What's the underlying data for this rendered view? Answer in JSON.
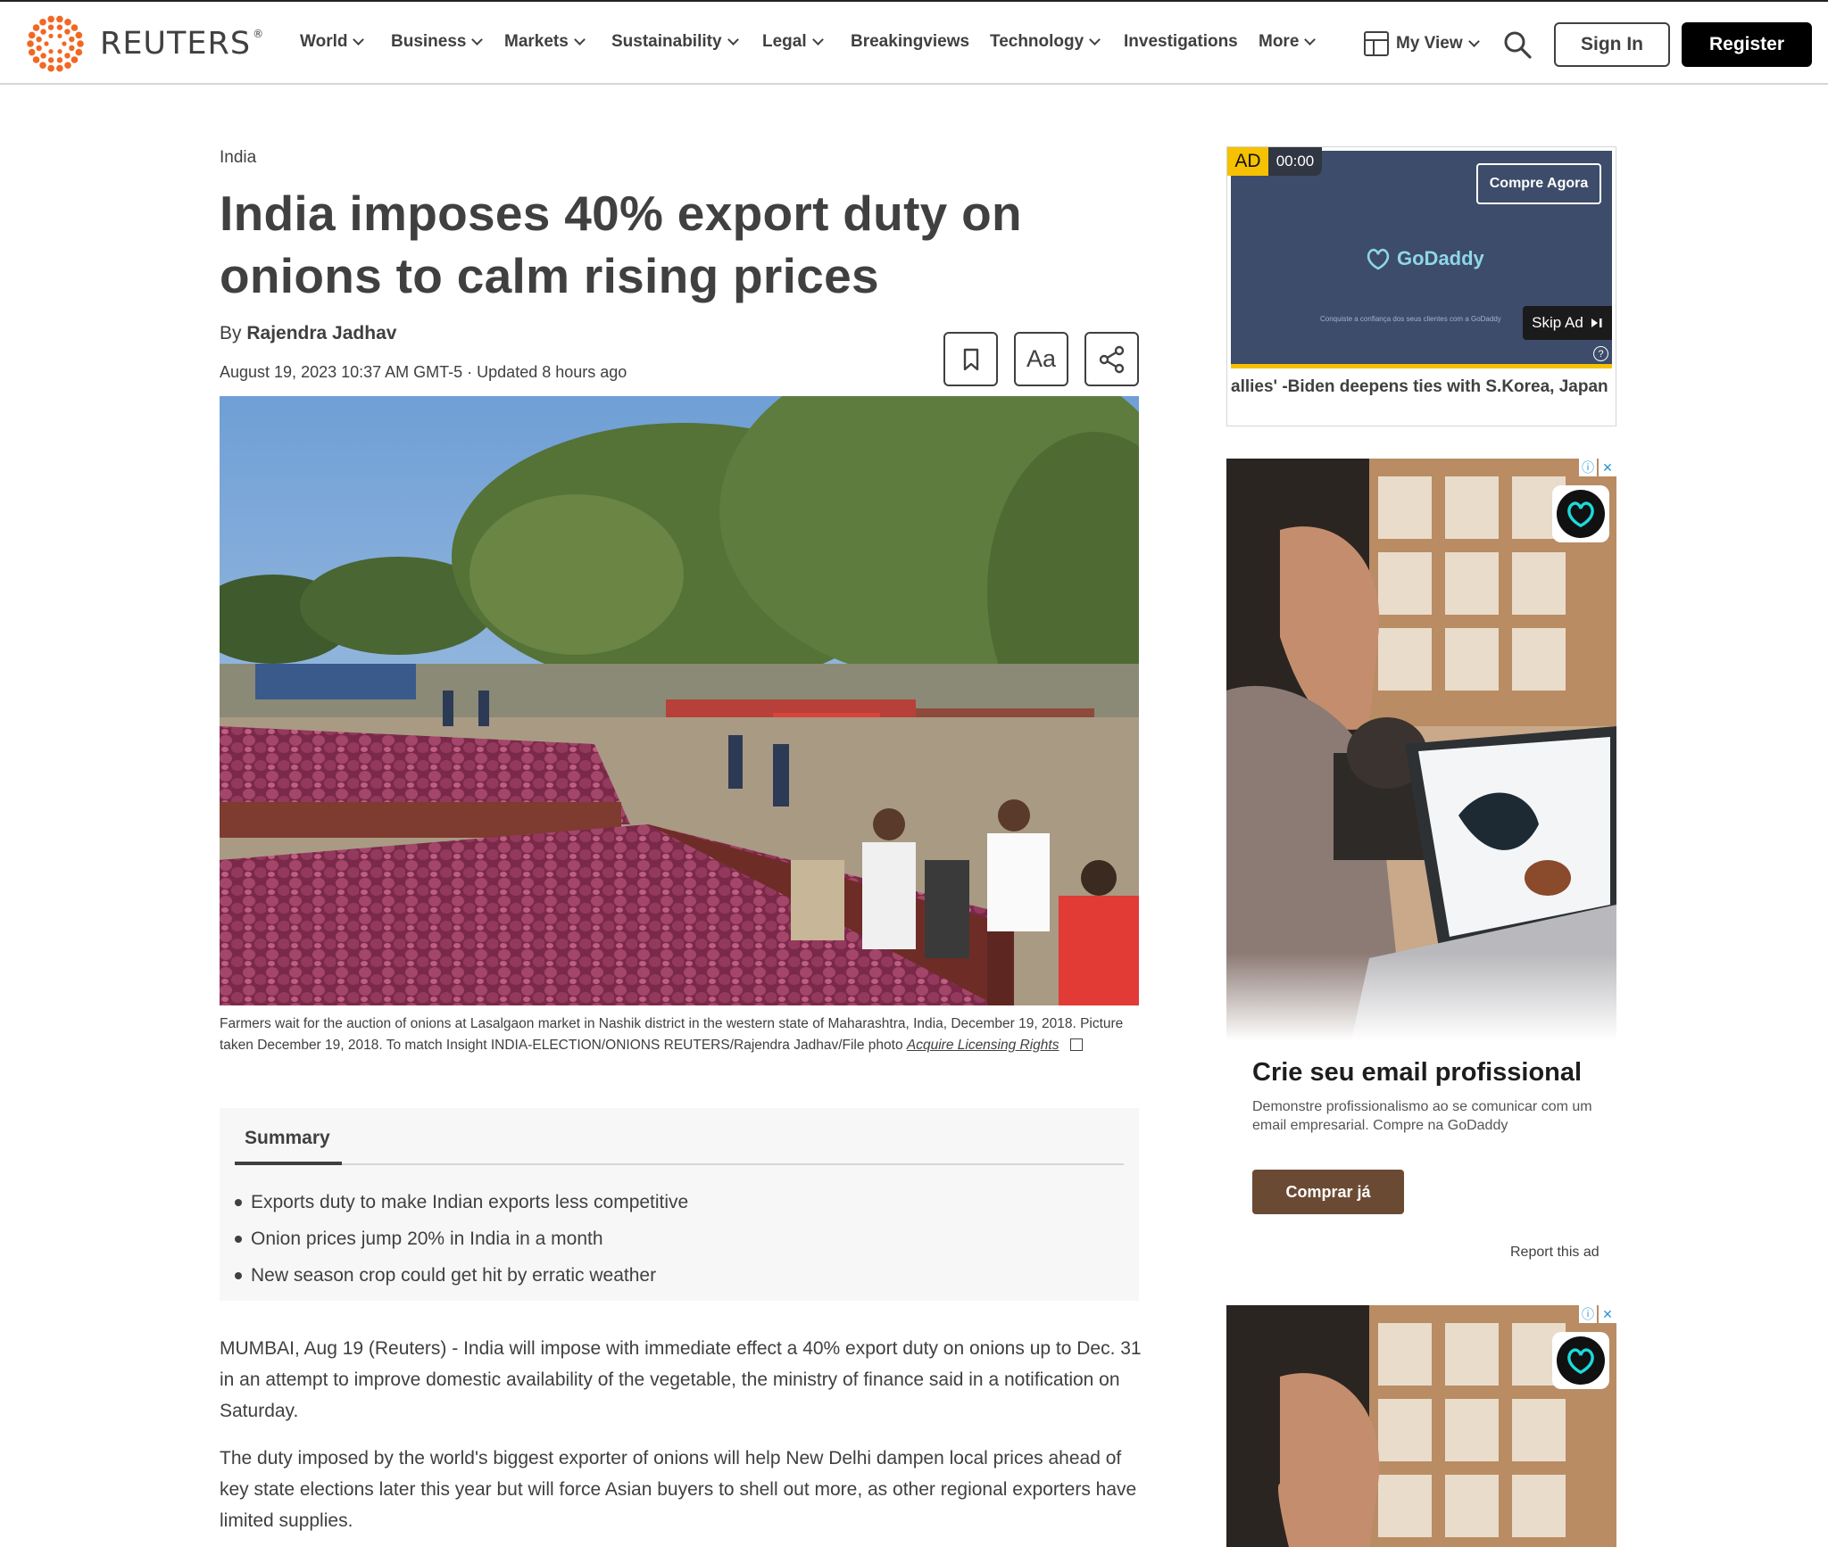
{
  "header": {
    "brand": "REUTERS",
    "brand_mark": "®",
    "nav": [
      {
        "label": "World",
        "has_menu": true
      },
      {
        "label": "Business",
        "has_menu": true
      },
      {
        "label": "Markets",
        "has_menu": true
      },
      {
        "label": "Sustainability",
        "has_menu": true
      },
      {
        "label": "Legal",
        "has_menu": true
      },
      {
        "label": "Breakingviews",
        "has_menu": false
      },
      {
        "label": "Technology",
        "has_menu": true
      },
      {
        "label": "Investigations",
        "has_menu": false
      },
      {
        "label": "More",
        "has_menu": true
      }
    ],
    "my_view": "My View",
    "sign_in": "Sign In",
    "register": "Register",
    "brand_color": "#f26722"
  },
  "article": {
    "section": "India",
    "headline": "India imposes 40% export duty on onions to calm rising prices",
    "byline_prefix": "By",
    "author": "Rajendra Jadhav",
    "dateline": "August 19, 2023 10:37 AM GMT-5 · Updated 8 hours ago",
    "font_button": "Aa",
    "caption": "Farmers wait for the auction of onions at Lasalgaon market in Nashik district in the western state of Maharashtra, India, December 19, 2018. Picture taken December 19, 2018. To match Insight INDIA-ELECTION/ONIONS REUTERS/Rajendra Jadhav/File photo",
    "caption_link": "Acquire Licensing Rights",
    "summary_title": "Summary",
    "summary_items": [
      "Exports duty to make Indian exports less competitive",
      "Onion prices jump 20% in India in a month",
      "New season crop could get hit by erratic weather"
    ],
    "paragraphs": [
      "MUMBAI, Aug 19 (Reuters) - India will impose with immediate effect a 40% export duty on onions up to Dec. 31 in an attempt to improve domestic availability of the vegetable, the ministry of finance said in a notification on Saturday.",
      "The duty imposed by the world's biggest exporter of onions will help New Delhi dampen local prices ahead of key state elections later this year but will force Asian buyers to shell out more, as other regional exporters have limited supplies."
    ]
  },
  "video_ad": {
    "badge": "AD",
    "time": "00:00",
    "cta": "Compre Agora",
    "brand": "GoDaddy",
    "tagline": "Conquiste a confiança dos seus clientes com a GoDaddy",
    "skip": "Skip Ad",
    "help": "?",
    "ticker": "allies' -Biden deepens ties with S.Korea, Japan"
  },
  "banner_ad": {
    "title": "Crie seu email profissional",
    "body": "Demonstre profissionalismo ao se comunicar com um email empresarial. Compre na GoDaddy",
    "cta": "Comprar já",
    "report": "Report this ad",
    "accent": "#6b4a34"
  }
}
